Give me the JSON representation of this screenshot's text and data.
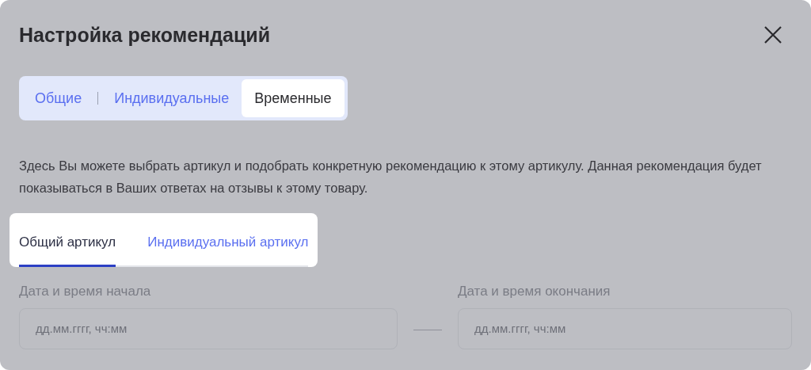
{
  "dialog": {
    "title": "Настройка рекомендаций"
  },
  "tabs": [
    {
      "label": "Общие",
      "selected": false
    },
    {
      "label": "Индивидуальные",
      "selected": false
    },
    {
      "label": "Временные",
      "selected": true
    }
  ],
  "description": "Здесь Вы можете выбрать артикул и подобрать конкретную рекомендацию к этому артикулу. Данная рекомендация будет показываться в Ваших ответах на отзывы к этому товару.",
  "subtabs": [
    {
      "label": "Общий артикул",
      "selected": true
    },
    {
      "label": "Индивидуальный артикул",
      "selected": false
    }
  ],
  "fields": [
    {
      "label": "Дата и время начала",
      "placeholder": "дд.мм.гггг, чч:мм"
    },
    {
      "label": "Дата и время окончания",
      "placeholder": "дд.мм.гггг, чч:мм"
    }
  ]
}
